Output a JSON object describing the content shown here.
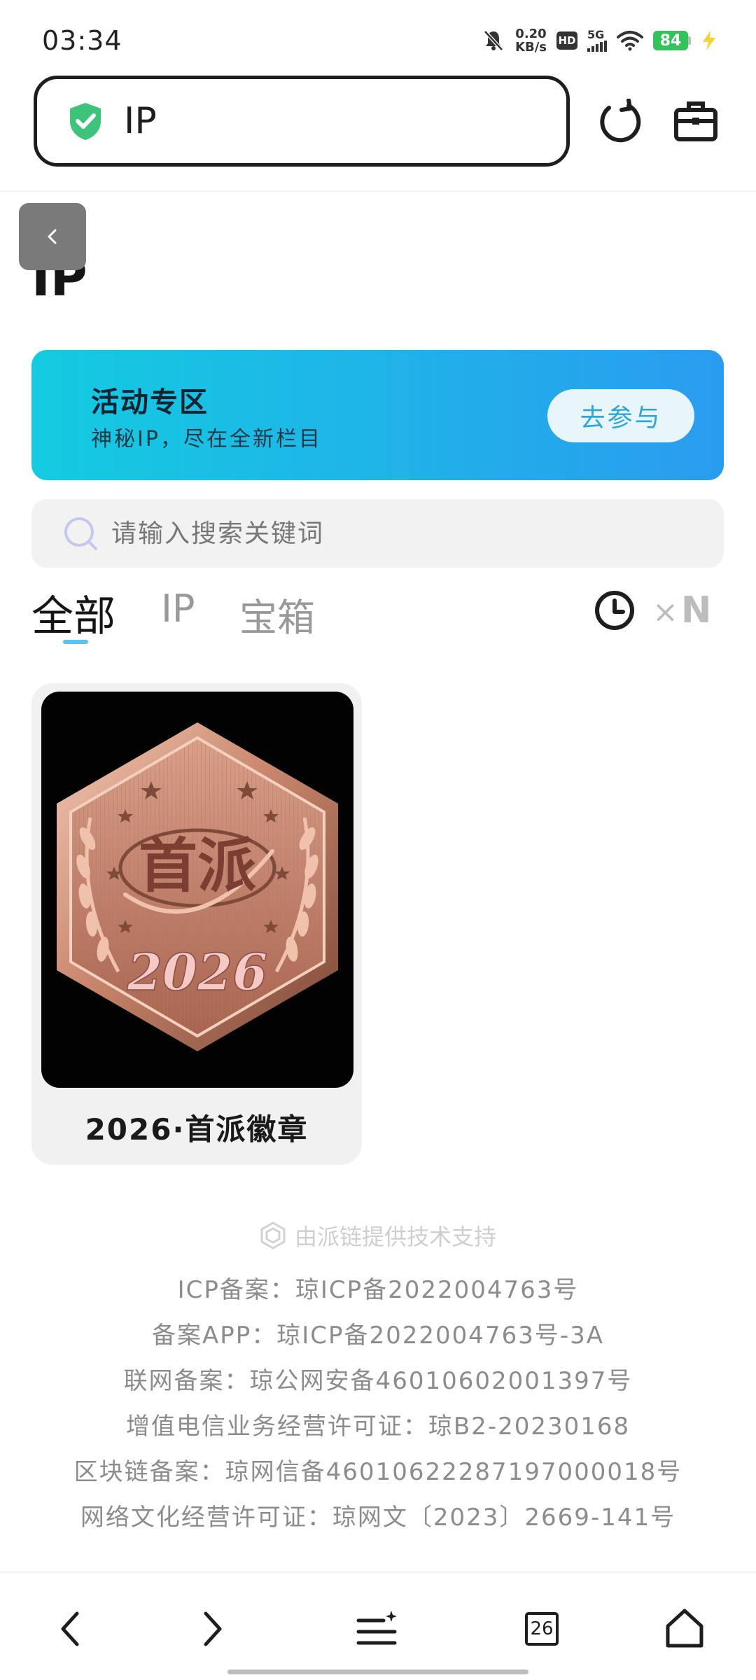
{
  "status_bar": {
    "time": "03:34",
    "net_speed_value": "0.20",
    "net_speed_unit": "KB/s",
    "hd_label": "HD",
    "network_label": "5G",
    "battery_level": "84"
  },
  "address_bar": {
    "text": "IP"
  },
  "page": {
    "heading": "IP"
  },
  "banner": {
    "title": "活动专区",
    "subtitle": "神秘IP，尽在全新栏目",
    "button_label": "去参与"
  },
  "search": {
    "placeholder": "请输入搜索关键词"
  },
  "tabs": [
    {
      "label": "全部",
      "active": true
    },
    {
      "label": "IP",
      "active": false
    },
    {
      "label": "宝箱",
      "active": false
    }
  ],
  "multiplier": {
    "x": "×",
    "n": "N"
  },
  "items": [
    {
      "title": "2026·首派徽章",
      "badge_text": "首派",
      "badge_year": "2026"
    }
  ],
  "footer": {
    "powered_by": "由派链提供技术支持",
    "lines": [
      "ICP备案：琼ICP备2022004763号",
      "备案APP：琼ICP备2022004763号-3A",
      "联网备案：琼公网安备46010602001397号",
      "增值电信业务经营许可证：琼B2-20230168",
      "区块链备案：琼网信备46010622287197000018号",
      "网络文化经营许可证：琼网文〔2023〕2669-141号"
    ]
  },
  "bottom_nav": {
    "tab_count": "26"
  },
  "colors": {
    "banner_start": "#14cbe0",
    "banner_end": "#2a9cf0",
    "shield_green": "#3ec37a",
    "tab_indicator": "#55c6f0",
    "battery_green": "#33c35a"
  }
}
